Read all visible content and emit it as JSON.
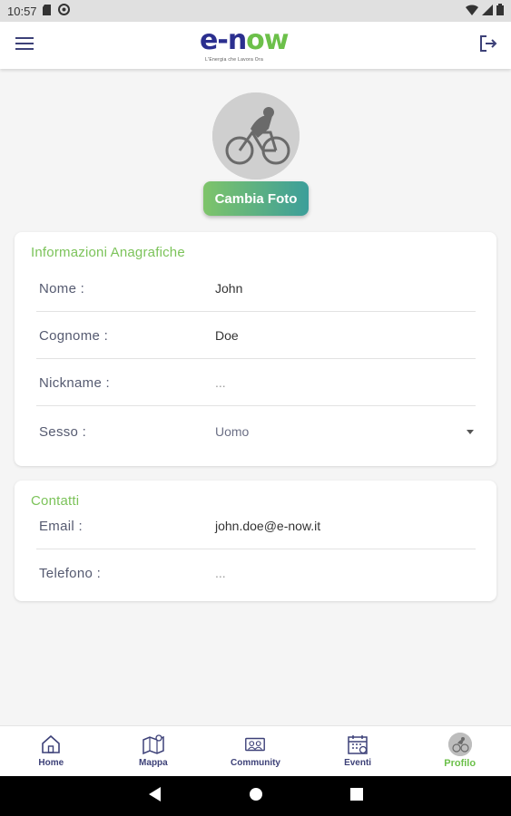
{
  "statusbar": {
    "time": "10:57"
  },
  "appbar": {
    "logo_text": "e-now",
    "logo_tagline": "L'Energia che Lavora Ora",
    "menu_icon": "hamburger-icon",
    "logout_icon": "logout-icon"
  },
  "profile": {
    "change_photo_label": "Cambia Foto"
  },
  "anagrafica": {
    "title": "Informazioni Anagrafiche",
    "rows": [
      {
        "label": "Nome :",
        "value": "John"
      },
      {
        "label": "Cognome :",
        "value": "Doe"
      },
      {
        "label": "Nickname :",
        "value": "..."
      },
      {
        "label": "Sesso :",
        "value": "Uomo"
      }
    ]
  },
  "contatti": {
    "title": "Contatti",
    "rows": [
      {
        "label": "Email :",
        "value": "john.doe@e-now.it"
      },
      {
        "label": "Telefono :",
        "value": "..."
      }
    ]
  },
  "bottomnav": {
    "items": [
      {
        "label": "Home",
        "icon": "home-icon"
      },
      {
        "label": "Mappa",
        "icon": "map-icon"
      },
      {
        "label": "Community",
        "icon": "community-icon"
      },
      {
        "label": "Eventi",
        "icon": "calendar-icon"
      },
      {
        "label": "Profilo",
        "icon": "profile-icon",
        "active": true
      }
    ]
  },
  "colors": {
    "brand_blue": "#2b2f8f",
    "brand_green": "#6cc04a",
    "section_title": "#7cc35a",
    "nav_label": "#3d4178"
  }
}
